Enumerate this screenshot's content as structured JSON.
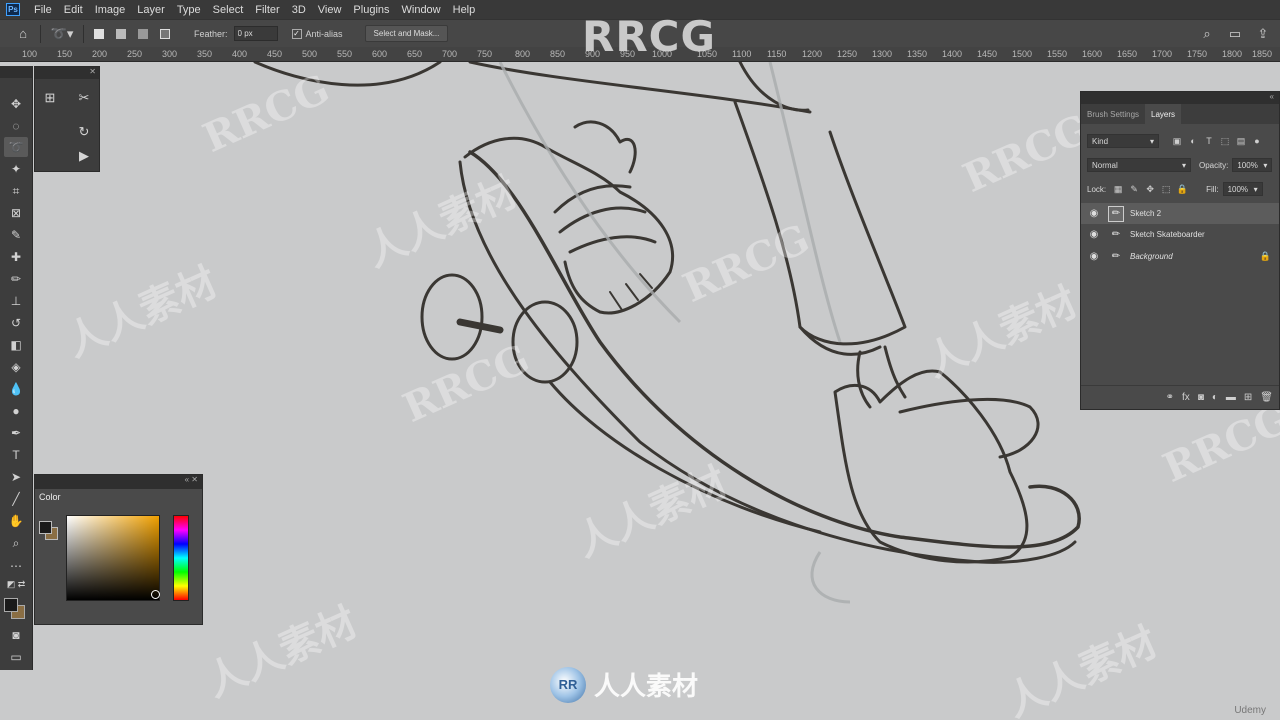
{
  "app": {
    "logo_text": "Ps"
  },
  "menu": [
    "File",
    "Edit",
    "Image",
    "Layer",
    "Type",
    "Select",
    "Filter",
    "3D",
    "View",
    "Plugins",
    "Window",
    "Help"
  ],
  "options_bar": {
    "feather_label": "Feather:",
    "feather_value": "0 px",
    "antialias_label": "Anti-alias",
    "antialias_checked": true,
    "select_mask_label": "Select and Mask..."
  },
  "ruler": {
    "ticks": [
      "100",
      "150",
      "200",
      "250",
      "300",
      "350",
      "400",
      "450",
      "500",
      "550",
      "600",
      "650",
      "700",
      "750",
      "800",
      "850",
      "900",
      "950",
      "1000",
      "1050",
      "1100",
      "1150",
      "1200",
      "1250",
      "1300",
      "1350",
      "1400",
      "1450",
      "1500",
      "1550",
      "1600",
      "1650",
      "1700",
      "1750",
      "1800",
      "1850"
    ]
  },
  "color_panel": {
    "tab": "Color",
    "foreground": "#1a1a1a",
    "background": "#8a6e44",
    "hue_accent": "#f0a000"
  },
  "layers_panel": {
    "tabs": [
      "Brush Settings",
      "Layers"
    ],
    "active_tab": "Layers",
    "filter_label": "Kind",
    "blend_mode": "Normal",
    "opacity_label": "Opacity:",
    "opacity_value": "100%",
    "lock_label": "Lock:",
    "fill_label": "Fill:",
    "fill_value": "100%",
    "layers": [
      {
        "name": "Sketch 2",
        "selected": true,
        "locked": false
      },
      {
        "name": "Sketch Skateboarder",
        "selected": false,
        "locked": false
      },
      {
        "name": "Background",
        "selected": false,
        "locked": true
      }
    ]
  },
  "watermarks": {
    "top": "RRCG",
    "bottom_logo": "RR",
    "bottom": "人人素材",
    "repeat_latin": "RRCG",
    "repeat_cjk": "人人素材"
  },
  "footer": {
    "udemy": "Udemy"
  }
}
